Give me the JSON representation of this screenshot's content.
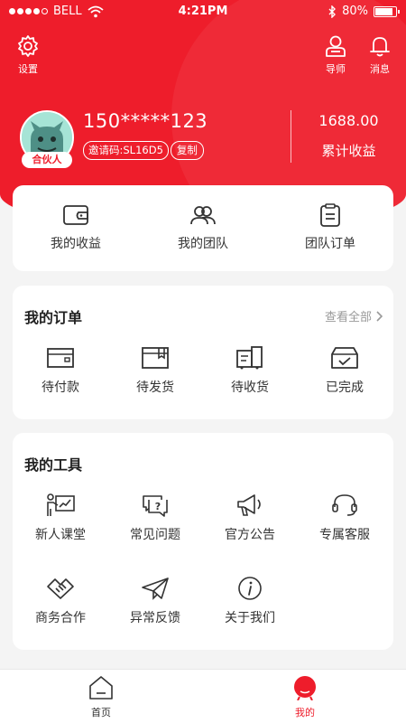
{
  "status_bar": {
    "carrier": "BELL",
    "time": "4:21PM",
    "battery": "80%"
  },
  "header": {
    "settings_label": "设置",
    "mentor_label": "导师",
    "messages_label": "消息"
  },
  "profile": {
    "phone": "150*****123",
    "invite_code": "邀请码:SL16D5",
    "copy_label": "复制",
    "badge": "合伙人",
    "total_earnings_value": "1688.00",
    "total_earnings_label": "累计收益"
  },
  "stats": [
    {
      "label": "我的收益",
      "icon": "wallet-icon"
    },
    {
      "label": "我的团队",
      "icon": "team-icon"
    },
    {
      "label": "团队订单",
      "icon": "clipboard-icon"
    }
  ],
  "orders": {
    "title": "我的订单",
    "view_all": "查看全部",
    "items": [
      {
        "label": "待付款",
        "icon": "pending-payment-icon"
      },
      {
        "label": "待发货",
        "icon": "pending-shipment-icon"
      },
      {
        "label": "待收货",
        "icon": "pending-receipt-icon"
      },
      {
        "label": "已完成",
        "icon": "completed-icon"
      }
    ]
  },
  "tools": {
    "title": "我的工具",
    "items": [
      {
        "label": "新人课堂",
        "icon": "classroom-icon"
      },
      {
        "label": "常见问题",
        "icon": "faq-icon"
      },
      {
        "label": "官方公告",
        "icon": "megaphone-icon"
      },
      {
        "label": "专属客服",
        "icon": "headset-icon"
      },
      {
        "label": "商务合作",
        "icon": "handshake-icon"
      },
      {
        "label": "异常反馈",
        "icon": "paper-plane-icon"
      },
      {
        "label": "关于我们",
        "icon": "info-icon"
      }
    ]
  },
  "bottom_nav": {
    "items": [
      {
        "label": "首页",
        "icon": "home-icon"
      },
      {
        "label": "我的",
        "icon": "profile-icon"
      }
    ],
    "active": "我的"
  },
  "colors": {
    "accent": "#ee1d2b",
    "background": "#f4f4f4"
  }
}
